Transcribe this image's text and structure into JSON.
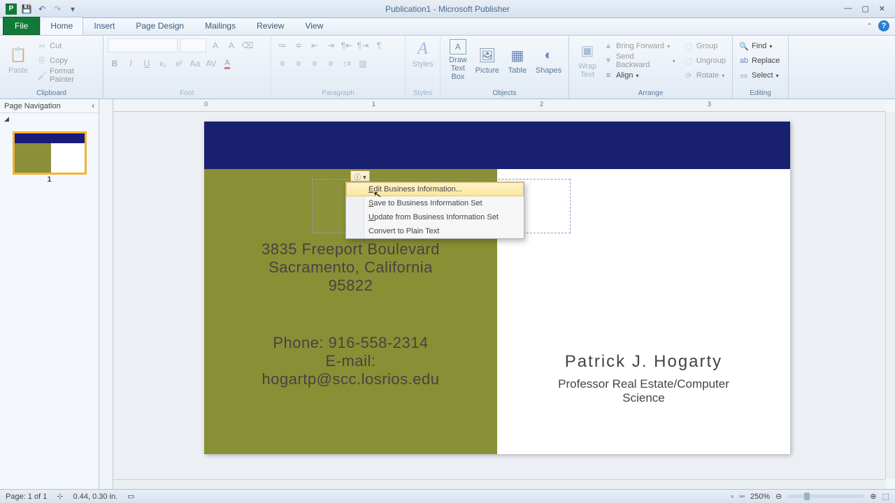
{
  "title": "Publication1 - Microsoft Publisher",
  "tabs": {
    "file": "File",
    "home": "Home",
    "insert": "Insert",
    "pagedesign": "Page Design",
    "mailings": "Mailings",
    "review": "Review",
    "view": "View"
  },
  "ribbon": {
    "clipboard": {
      "paste": "Paste",
      "cut": "Cut",
      "copy": "Copy",
      "fmt": "Format Painter",
      "label": "Clipboard"
    },
    "font": {
      "label": "Font"
    },
    "paragraph": {
      "label": "Paragraph"
    },
    "styles": {
      "btn": "Styles",
      "label": "Styles"
    },
    "objects": {
      "drawtb": "Draw\nText Box",
      "picture": "Picture",
      "table": "Table",
      "shapes": "Shapes",
      "label": "Objects"
    },
    "wrap": {
      "btn": "Wrap\nText",
      "bf": "Bring Forward",
      "sb": "Send Backward",
      "align": "Align",
      "group": "Group",
      "ungroup": "Ungroup",
      "rotate": "Rotate",
      "label": "Arrange"
    },
    "editing": {
      "find": "Find",
      "replace": "Replace",
      "select": "Select",
      "label": "Editing"
    }
  },
  "nav": {
    "title": "Page Navigation",
    "page": "1"
  },
  "ruler": {
    "t0": "0",
    "t1": "1",
    "t2": "2",
    "t3": "3"
  },
  "card": {
    "collegeVisible": "Y",
    "addr1": "3835 Freeport Boulevard",
    "addr2": "Sacramento, California",
    "addr3": "95822",
    "phone": "Phone: 916-558-2314",
    "email1": "E-mail:",
    "email2": "hogartp@scc.losrios.edu",
    "name": "Patrick J. Hogarty",
    "title": "Professor Real Estate/Computer\nScience"
  },
  "context": {
    "i1": "Edit Business Information...",
    "i2": "Save to Business Information Set",
    "i3": "Update from Business Information Set",
    "i4": "Convert to Plain Text"
  },
  "status": {
    "page": "Page: 1 of 1",
    "pos": "0.44, 0.30 in.",
    "zoom": "250%"
  }
}
